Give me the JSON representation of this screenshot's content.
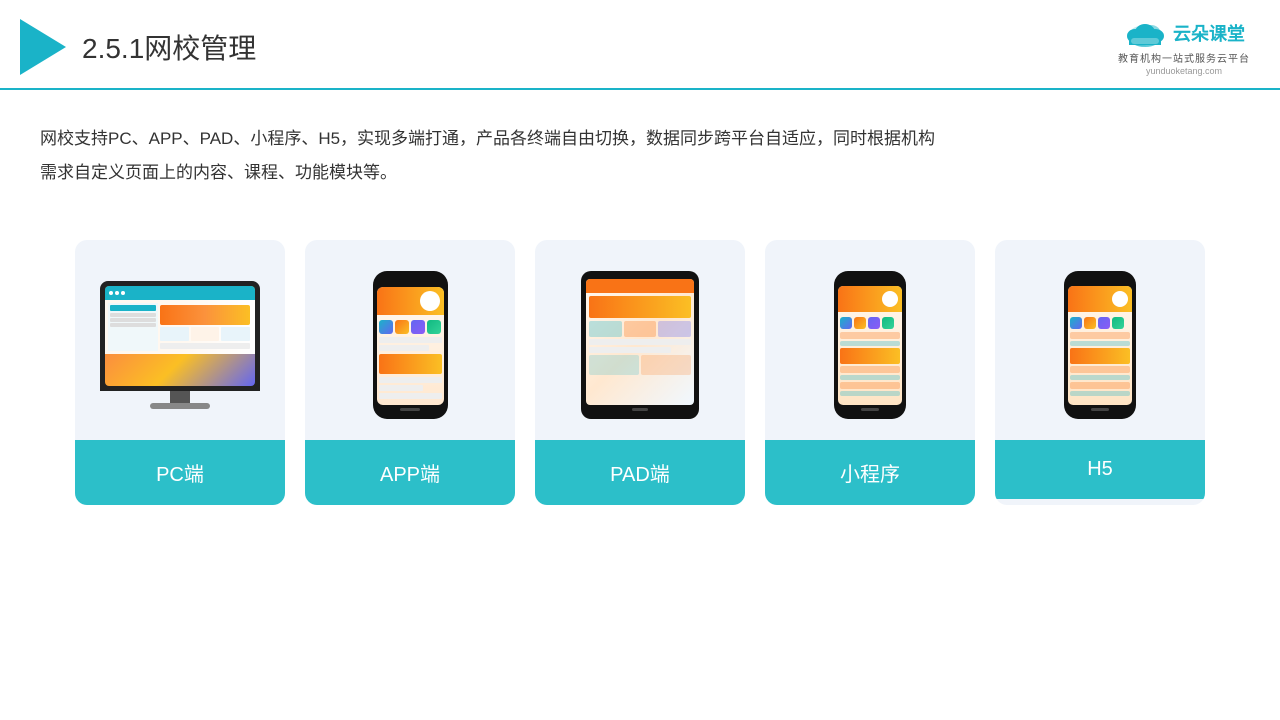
{
  "header": {
    "title_prefix": "2.5.1",
    "title_main": "网校管理",
    "logo_main": "云朵课堂",
    "logo_tagline1": "教育机构一站",
    "logo_tagline2": "式服务云平台",
    "logo_url": "yunduoketang.com"
  },
  "description": {
    "text_line1": "网校支持PC、APP、PAD、小程序、H5，实现多端打通，产品各终端自由切换，数据同步跨平台自适应，同时根据机构",
    "text_line2": "需求自定义页面上的内容、课程、功能模块等。"
  },
  "cards": [
    {
      "id": "pc",
      "label": "PC端"
    },
    {
      "id": "app",
      "label": "APP端"
    },
    {
      "id": "pad",
      "label": "PAD端"
    },
    {
      "id": "miniprogram",
      "label": "小程序"
    },
    {
      "id": "h5",
      "label": "H5"
    }
  ]
}
